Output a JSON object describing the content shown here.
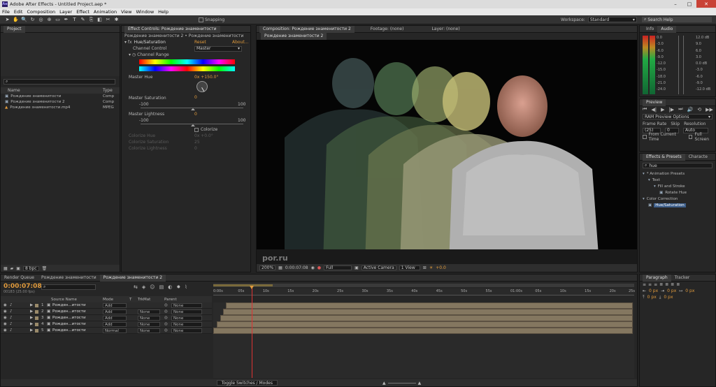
{
  "window": {
    "title": "Adobe After Effects - Untitled Project.aep *",
    "min": "–",
    "max": "□",
    "close": "✕"
  },
  "menu": [
    "File",
    "Edit",
    "Composition",
    "Layer",
    "Effect",
    "Animation",
    "View",
    "Window",
    "Help"
  ],
  "toolbar": {
    "snapping_label": "Snapping",
    "workspace_label": "Workspace:",
    "workspace_value": "Standard",
    "search_placeholder": "Search Help"
  },
  "project": {
    "tab": "Project",
    "col_name": "Name",
    "col_type": "Type",
    "items": [
      {
        "name": "Рождение знаменитости",
        "type": "Comp"
      },
      {
        "name": "Рождение знаменитости 2",
        "type": "Comp"
      },
      {
        "name": "Рождение знаменитости.mp4",
        "type": "MPEG"
      }
    ],
    "bpc": "8 bpc"
  },
  "effect_controls": {
    "tab": "Effect Controls: Рождение знаменитости",
    "breadcrumb": "Рождение знаменитости 2 • Рождение знаменитости",
    "effect_name": "Hue/Saturation",
    "reset": "Reset",
    "about": "About...",
    "channel_control_label": "Channel Control",
    "channel_control_value": "Master",
    "channel_range_label": "Channel Range",
    "master_hue_label": "Master Hue",
    "master_hue_value": "0x +150.0°",
    "master_sat_label": "Master Saturation",
    "master_sat_value": "0",
    "sat_min": "-100",
    "sat_max": "100",
    "master_light_label": "Master Lightness",
    "master_light_value": "0",
    "light_min": "-100",
    "light_max": "100",
    "colorize_label": "Colorize",
    "colorize_hue_label": "Colorize Hue",
    "colorize_hue_value": "0x +0.0°",
    "colorize_sat_label": "Colorize Saturation",
    "colorize_sat_value": "25",
    "colorize_light_label": "Colorize Lightness",
    "colorize_light_value": "0"
  },
  "composition": {
    "tab": "Composition: Рождение знаменитости 2",
    "footage_tab": "Footage: (none)",
    "layer_tab": "Layer: (none)",
    "subtab": "Рождение знаменитости 2",
    "watermark": "por.ru",
    "zoom": "200%",
    "timecode": "0:00:07:08",
    "resolution": "Full",
    "camera": "Active Camera",
    "view": "1 View",
    "exposure": "+0.0"
  },
  "info_audio": {
    "tabs": [
      "Info",
      "Audio"
    ],
    "db_left": [
      "0.0",
      "-3.0",
      "-6.0",
      "-9.0",
      "-12.0",
      "-15.0",
      "-18.0",
      "-21.0",
      "-24.0"
    ],
    "db_right": [
      "12.0 dB",
      "9.0",
      "6.0",
      "3.0",
      "0.0 dB",
      "-3.0",
      "-6.0",
      "-9.0",
      "-12.0 dB"
    ]
  },
  "preview": {
    "tab": "Preview",
    "ram_options": "RAM Preview Options",
    "frame_rate_label": "Frame Rate",
    "skip_label": "Skip",
    "resolution_label": "Resolution",
    "frame_rate_value": "(25)",
    "skip_value": "0",
    "resolution_value": "Auto",
    "from_current": "From Current Time",
    "full_screen": "Full Screen"
  },
  "effects_presets": {
    "tabs": [
      "Effects & Presets",
      "Characte"
    ],
    "search_value": "hue",
    "tree": [
      {
        "label": "* Animation Presets",
        "indent": 0
      },
      {
        "label": "Text",
        "indent": 1
      },
      {
        "label": "Fill and Stroke",
        "indent": 2
      },
      {
        "label": "Rotate Hue",
        "indent": 3
      },
      {
        "label": "Color Correction",
        "indent": 0
      },
      {
        "label": "Hue/Saturation",
        "indent": 1
      }
    ]
  },
  "paragraph": {
    "tabs": [
      "Paragraph",
      "Tracker"
    ],
    "px_values": [
      "0 px",
      "0 px",
      "0 px",
      "0 px",
      "0 px"
    ]
  },
  "timeline": {
    "tabs": [
      "Render Queue",
      "Рождение знаменитости",
      "Рождение знаменитости 2"
    ],
    "timecode": "0:00:07:08",
    "fps": "00183 (25.00 fps)",
    "col_source": "Source Name",
    "col_mode": "Mode",
    "col_t": "T",
    "col_trkmat": "TrkMat",
    "col_parent": "Parent",
    "layers": [
      {
        "num": "1",
        "name": "Рожден...итости",
        "mode": "Add",
        "trkmat": "",
        "parent": "None",
        "start": 0.03
      },
      {
        "num": "2",
        "name": "Рожден...итости",
        "mode": "Add",
        "trkmat": "None",
        "parent": "None",
        "start": 0.024
      },
      {
        "num": "3",
        "name": "Рожден...итости",
        "mode": "Add",
        "trkmat": "None",
        "parent": "None",
        "start": 0.016
      },
      {
        "num": "4",
        "name": "Рожден...итости",
        "mode": "Add",
        "trkmat": "None",
        "parent": "None",
        "start": 0.008
      },
      {
        "num": "5",
        "name": "Рожден...итости",
        "mode": "Normal",
        "trkmat": "None",
        "parent": "None",
        "start": 0.0
      }
    ],
    "ruler": [
      "0:00s",
      "05s",
      "10s",
      "15s",
      "20s",
      "25s",
      "30s",
      "35s",
      "40s",
      "45s",
      "50s",
      "55s",
      "01:00s",
      "05s",
      "10s",
      "15s",
      "20s",
      "25s"
    ],
    "playhead_fraction": 0.0917,
    "toggle_label": "Toggle Switches / Modes"
  }
}
